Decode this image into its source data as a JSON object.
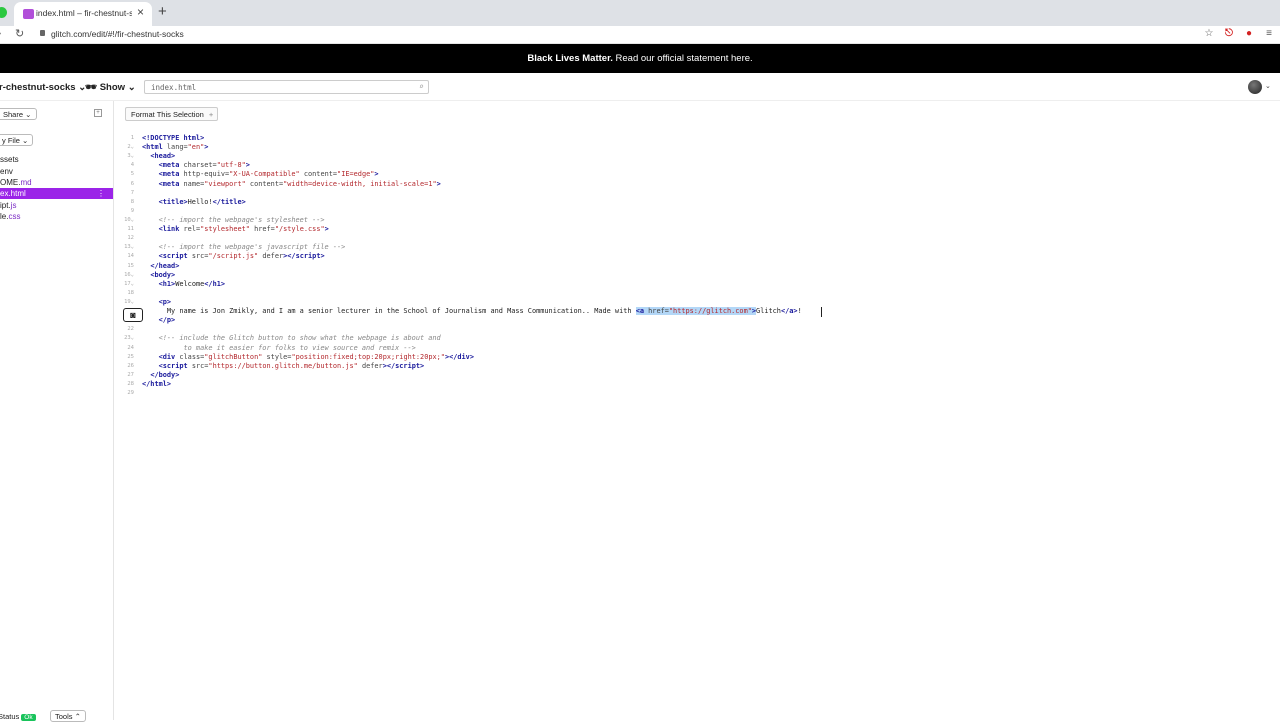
{
  "browser": {
    "tab_title": "index.html – fir-chestnut-socks",
    "tab_close": "×",
    "new_tab": "+",
    "url": "glitch.com/edit/#!/fir-chestnut-socks",
    "forward": "›",
    "reload": "↻",
    "icons": [
      "star-icon",
      "pdf-extension-icon",
      "adblock-extension-icon",
      "menu-icon"
    ]
  },
  "banner": {
    "bold": "Black Lives Matter.",
    "link": "Read our official statement here."
  },
  "header": {
    "project_name": "r-chestnut-socks",
    "show_label": "Show",
    "search_value": "index.html"
  },
  "sidebar": {
    "share_label": "Share",
    "new_file_label": "y File",
    "files": [
      {
        "name": "ssets",
        "ext": ""
      },
      {
        "name": "env",
        "ext": ""
      },
      {
        "name": "OME.",
        "ext": "md"
      },
      {
        "name": "ex.html",
        "ext": ""
      },
      {
        "name": "ipt.",
        "ext": "js"
      },
      {
        "name": "le.",
        "ext": "css"
      }
    ],
    "status_label": "Status",
    "status_badge": "Ok",
    "tools_label": "Tools"
  },
  "editor": {
    "format_label": "Format This Selection",
    "line_numbers": [
      "1",
      "2",
      "3",
      "4",
      "5",
      "6",
      "7",
      "8",
      "9",
      "10",
      "11",
      "12",
      "13",
      "14",
      "15",
      "16",
      "17",
      "18",
      "19",
      "20",
      "21",
      "22",
      "23",
      "24",
      "25",
      "26",
      "27",
      "28",
      "29"
    ]
  }
}
